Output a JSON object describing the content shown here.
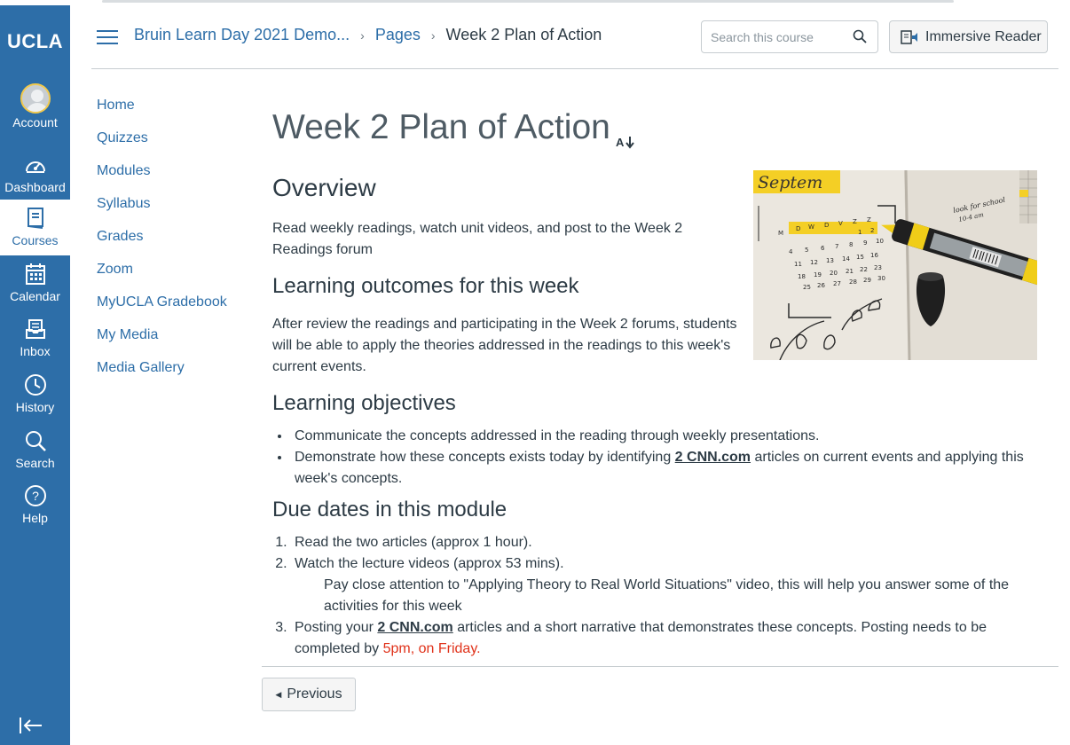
{
  "global_nav": {
    "logo": "UCLA",
    "items": [
      {
        "label": "Account",
        "icon": "account-avatar-icon"
      },
      {
        "label": "Dashboard",
        "icon": "dashboard-icon"
      },
      {
        "label": "Courses",
        "icon": "courses-icon"
      },
      {
        "label": "Calendar",
        "icon": "calendar-icon"
      },
      {
        "label": "Inbox",
        "icon": "inbox-icon"
      },
      {
        "label": "History",
        "icon": "history-icon"
      },
      {
        "label": "Search",
        "icon": "search-icon"
      },
      {
        "label": "Help",
        "icon": "help-icon"
      }
    ],
    "active": "Courses",
    "colors": {
      "background": "#2d6ea8",
      "accent": "#f2c94c"
    }
  },
  "header": {
    "breadcrumbs": [
      "Bruin Learn Day 2021 Demo...",
      "Pages",
      "Week 2 Plan of Action"
    ],
    "search_placeholder": "Search this course",
    "immersive_reader_label": "Immersive Reader"
  },
  "course_nav": [
    "Home",
    "Quizzes",
    "Modules",
    "Syllabus",
    "Grades",
    "Zoom",
    "MyUCLA Gradebook",
    "My Media",
    "Media Gallery"
  ],
  "page": {
    "title": "Week 2 Plan of Action",
    "overview_heading": "Overview",
    "overview_text": "Read weekly readings, watch unit videos, and post to the Week 2 Readings forum",
    "outcomes_heading": "Learning outcomes for this week",
    "outcomes_text": "After review the readings and participating in the Week 2 forums, students will be able to apply the theories addressed in the readings to this week's current events.",
    "objectives_heading": "Learning objectives",
    "objectives": [
      {
        "text": "Communicate the concepts addressed in the reading through weekly presentations."
      },
      {
        "before": "Demonstrate how these concepts exists today by identifying ",
        "link": "2 CNN.com",
        "after": " articles on current events and applying this week's concepts."
      }
    ],
    "due_heading": "Due dates in this module",
    "due_items": [
      {
        "text": "Read the two articles (approx 1 hour)."
      },
      {
        "text": "Watch the lecture videos (approx 53 mins).",
        "note": "Pay close attention to \"Applying Theory to Real World Situations\" video, this will help you answer some of the activities for this week"
      },
      {
        "before": "Posting your ",
        "link": "2 CNN.com",
        "after": " articles and a short narrative that demonstrates these concepts. Posting needs to be completed by ",
        "deadline": "5pm, on Friday."
      }
    ],
    "image_text": {
      "month": "Septem",
      "note_line1": "look for school",
      "note_line2": "10-4 am"
    },
    "previous_label": "Previous"
  }
}
